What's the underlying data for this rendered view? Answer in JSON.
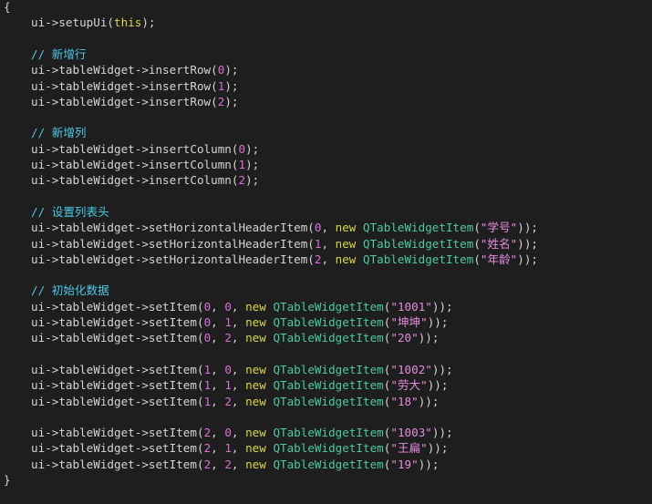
{
  "editor": {
    "theme": {
      "background": "#1e1e1e",
      "plain": "#d4d4d4",
      "keyword": "#d8d74d",
      "type": "#4ec9a0",
      "number": "#d86fd8",
      "string": "#e58be0",
      "comment": "#4ec9e8"
    },
    "lines": [
      {
        "y": 0,
        "tokens": [
          {
            "t": "{",
            "c": "brace"
          }
        ]
      },
      {
        "y": 1,
        "indent": 1,
        "tokens": [
          {
            "t": "ui->setupUi(",
            "c": "plain"
          },
          {
            "t": "this",
            "c": "keyword"
          },
          {
            "t": ");",
            "c": "plain"
          }
        ]
      },
      {
        "y": 3,
        "indent": 1,
        "tokens": [
          {
            "t": "// 新增行",
            "c": "comment"
          }
        ]
      },
      {
        "y": 4,
        "indent": 1,
        "tokens": [
          {
            "t": "ui->tableWidget->insertRow(",
            "c": "plain"
          },
          {
            "t": "0",
            "c": "number"
          },
          {
            "t": ");",
            "c": "plain"
          }
        ]
      },
      {
        "y": 5,
        "indent": 1,
        "tokens": [
          {
            "t": "ui->tableWidget->insertRow(",
            "c": "plain"
          },
          {
            "t": "1",
            "c": "number"
          },
          {
            "t": ");",
            "c": "plain"
          }
        ]
      },
      {
        "y": 6,
        "indent": 1,
        "tokens": [
          {
            "t": "ui->tableWidget->insertRow(",
            "c": "plain"
          },
          {
            "t": "2",
            "c": "number"
          },
          {
            "t": ");",
            "c": "plain"
          }
        ]
      },
      {
        "y": 8,
        "indent": 1,
        "tokens": [
          {
            "t": "// 新增列",
            "c": "comment"
          }
        ]
      },
      {
        "y": 9,
        "indent": 1,
        "tokens": [
          {
            "t": "ui->tableWidget->insertColumn(",
            "c": "plain"
          },
          {
            "t": "0",
            "c": "number"
          },
          {
            "t": ");",
            "c": "plain"
          }
        ]
      },
      {
        "y": 10,
        "indent": 1,
        "tokens": [
          {
            "t": "ui->tableWidget->insertColumn(",
            "c": "plain"
          },
          {
            "t": "1",
            "c": "number"
          },
          {
            "t": ");",
            "c": "plain"
          }
        ]
      },
      {
        "y": 11,
        "indent": 1,
        "tokens": [
          {
            "t": "ui->tableWidget->insertColumn(",
            "c": "plain"
          },
          {
            "t": "2",
            "c": "number"
          },
          {
            "t": ");",
            "c": "plain"
          }
        ]
      },
      {
        "y": 13,
        "indent": 1,
        "tokens": [
          {
            "t": "// 设置列表头",
            "c": "comment"
          }
        ]
      },
      {
        "y": 14,
        "indent": 1,
        "tokens": [
          {
            "t": "ui->tableWidget->setHorizontalHeaderItem(",
            "c": "plain"
          },
          {
            "t": "0",
            "c": "number"
          },
          {
            "t": ", ",
            "c": "plain"
          },
          {
            "t": "new",
            "c": "keyword"
          },
          {
            "t": " ",
            "c": "plain"
          },
          {
            "t": "QTableWidgetItem",
            "c": "type"
          },
          {
            "t": "(",
            "c": "plain"
          },
          {
            "t": "\"学号\"",
            "c": "string"
          },
          {
            "t": "));",
            "c": "plain"
          }
        ]
      },
      {
        "y": 15,
        "indent": 1,
        "tokens": [
          {
            "t": "ui->tableWidget->setHorizontalHeaderItem(",
            "c": "plain"
          },
          {
            "t": "1",
            "c": "number"
          },
          {
            "t": ", ",
            "c": "plain"
          },
          {
            "t": "new",
            "c": "keyword"
          },
          {
            "t": " ",
            "c": "plain"
          },
          {
            "t": "QTableWidgetItem",
            "c": "type"
          },
          {
            "t": "(",
            "c": "plain"
          },
          {
            "t": "\"姓名\"",
            "c": "string"
          },
          {
            "t": "));",
            "c": "plain"
          }
        ]
      },
      {
        "y": 16,
        "indent": 1,
        "tokens": [
          {
            "t": "ui->tableWidget->setHorizontalHeaderItem(",
            "c": "plain"
          },
          {
            "t": "2",
            "c": "number"
          },
          {
            "t": ", ",
            "c": "plain"
          },
          {
            "t": "new",
            "c": "keyword"
          },
          {
            "t": " ",
            "c": "plain"
          },
          {
            "t": "QTableWidgetItem",
            "c": "type"
          },
          {
            "t": "(",
            "c": "plain"
          },
          {
            "t": "\"年龄\"",
            "c": "string"
          },
          {
            "t": "));",
            "c": "plain"
          }
        ]
      },
      {
        "y": 18,
        "indent": 1,
        "tokens": [
          {
            "t": "// 初始化数据",
            "c": "comment"
          }
        ]
      },
      {
        "y": 19,
        "indent": 1,
        "tokens": [
          {
            "t": "ui->tableWidget->setItem(",
            "c": "plain"
          },
          {
            "t": "0",
            "c": "number"
          },
          {
            "t": ", ",
            "c": "plain"
          },
          {
            "t": "0",
            "c": "number"
          },
          {
            "t": ", ",
            "c": "plain"
          },
          {
            "t": "new",
            "c": "keyword"
          },
          {
            "t": " ",
            "c": "plain"
          },
          {
            "t": "QTableWidgetItem",
            "c": "type"
          },
          {
            "t": "(",
            "c": "plain"
          },
          {
            "t": "\"1001\"",
            "c": "string"
          },
          {
            "t": "));",
            "c": "plain"
          }
        ]
      },
      {
        "y": 20,
        "indent": 1,
        "tokens": [
          {
            "t": "ui->tableWidget->setItem(",
            "c": "plain"
          },
          {
            "t": "0",
            "c": "number"
          },
          {
            "t": ", ",
            "c": "plain"
          },
          {
            "t": "1",
            "c": "number"
          },
          {
            "t": ", ",
            "c": "plain"
          },
          {
            "t": "new",
            "c": "keyword"
          },
          {
            "t": " ",
            "c": "plain"
          },
          {
            "t": "QTableWidgetItem",
            "c": "type"
          },
          {
            "t": "(",
            "c": "plain"
          },
          {
            "t": "\"坤坤\"",
            "c": "string"
          },
          {
            "t": "));",
            "c": "plain"
          }
        ]
      },
      {
        "y": 21,
        "indent": 1,
        "tokens": [
          {
            "t": "ui->tableWidget->setItem(",
            "c": "plain"
          },
          {
            "t": "0",
            "c": "number"
          },
          {
            "t": ", ",
            "c": "plain"
          },
          {
            "t": "2",
            "c": "number"
          },
          {
            "t": ", ",
            "c": "plain"
          },
          {
            "t": "new",
            "c": "keyword"
          },
          {
            "t": " ",
            "c": "plain"
          },
          {
            "t": "QTableWidgetItem",
            "c": "type"
          },
          {
            "t": "(",
            "c": "plain"
          },
          {
            "t": "\"20\"",
            "c": "string"
          },
          {
            "t": "));",
            "c": "plain"
          }
        ]
      },
      {
        "y": 23,
        "indent": 1,
        "tokens": [
          {
            "t": "ui->tableWidget->setItem(",
            "c": "plain"
          },
          {
            "t": "1",
            "c": "number"
          },
          {
            "t": ", ",
            "c": "plain"
          },
          {
            "t": "0",
            "c": "number"
          },
          {
            "t": ", ",
            "c": "plain"
          },
          {
            "t": "new",
            "c": "keyword"
          },
          {
            "t": " ",
            "c": "plain"
          },
          {
            "t": "QTableWidgetItem",
            "c": "type"
          },
          {
            "t": "(",
            "c": "plain"
          },
          {
            "t": "\"1002\"",
            "c": "string"
          },
          {
            "t": "));",
            "c": "plain"
          }
        ]
      },
      {
        "y": 24,
        "indent": 1,
        "tokens": [
          {
            "t": "ui->tableWidget->setItem(",
            "c": "plain"
          },
          {
            "t": "1",
            "c": "number"
          },
          {
            "t": ", ",
            "c": "plain"
          },
          {
            "t": "1",
            "c": "number"
          },
          {
            "t": ", ",
            "c": "plain"
          },
          {
            "t": "new",
            "c": "keyword"
          },
          {
            "t": " ",
            "c": "plain"
          },
          {
            "t": "QTableWidgetItem",
            "c": "type"
          },
          {
            "t": "(",
            "c": "plain"
          },
          {
            "t": "\"劳大\"",
            "c": "string"
          },
          {
            "t": "));",
            "c": "plain"
          }
        ]
      },
      {
        "y": 25,
        "indent": 1,
        "tokens": [
          {
            "t": "ui->tableWidget->setItem(",
            "c": "plain"
          },
          {
            "t": "1",
            "c": "number"
          },
          {
            "t": ", ",
            "c": "plain"
          },
          {
            "t": "2",
            "c": "number"
          },
          {
            "t": ", ",
            "c": "plain"
          },
          {
            "t": "new",
            "c": "keyword"
          },
          {
            "t": " ",
            "c": "plain"
          },
          {
            "t": "QTableWidgetItem",
            "c": "type"
          },
          {
            "t": "(",
            "c": "plain"
          },
          {
            "t": "\"18\"",
            "c": "string"
          },
          {
            "t": "));",
            "c": "plain"
          }
        ]
      },
      {
        "y": 27,
        "indent": 1,
        "tokens": [
          {
            "t": "ui->tableWidget->setItem(",
            "c": "plain"
          },
          {
            "t": "2",
            "c": "number"
          },
          {
            "t": ", ",
            "c": "plain"
          },
          {
            "t": "0",
            "c": "number"
          },
          {
            "t": ", ",
            "c": "plain"
          },
          {
            "t": "new",
            "c": "keyword"
          },
          {
            "t": " ",
            "c": "plain"
          },
          {
            "t": "QTableWidgetItem",
            "c": "type"
          },
          {
            "t": "(",
            "c": "plain"
          },
          {
            "t": "\"1003\"",
            "c": "string"
          },
          {
            "t": "));",
            "c": "plain"
          }
        ]
      },
      {
        "y": 28,
        "indent": 1,
        "tokens": [
          {
            "t": "ui->tableWidget->setItem(",
            "c": "plain"
          },
          {
            "t": "2",
            "c": "number"
          },
          {
            "t": ", ",
            "c": "plain"
          },
          {
            "t": "1",
            "c": "number"
          },
          {
            "t": ", ",
            "c": "plain"
          },
          {
            "t": "new",
            "c": "keyword"
          },
          {
            "t": " ",
            "c": "plain"
          },
          {
            "t": "QTableWidgetItem",
            "c": "type"
          },
          {
            "t": "(",
            "c": "plain"
          },
          {
            "t": "\"王扁\"",
            "c": "string"
          },
          {
            "t": "));",
            "c": "plain"
          }
        ]
      },
      {
        "y": 29,
        "indent": 1,
        "tokens": [
          {
            "t": "ui->tableWidget->setItem(",
            "c": "plain"
          },
          {
            "t": "2",
            "c": "number"
          },
          {
            "t": ", ",
            "c": "plain"
          },
          {
            "t": "2",
            "c": "number"
          },
          {
            "t": ", ",
            "c": "plain"
          },
          {
            "t": "new",
            "c": "keyword"
          },
          {
            "t": " ",
            "c": "plain"
          },
          {
            "t": "QTableWidgetItem",
            "c": "type"
          },
          {
            "t": "(",
            "c": "plain"
          },
          {
            "t": "\"19\"",
            "c": "string"
          },
          {
            "t": "));",
            "c": "plain"
          }
        ]
      },
      {
        "y": 30,
        "tokens": [
          {
            "t": "}",
            "c": "brace"
          }
        ]
      }
    ]
  }
}
